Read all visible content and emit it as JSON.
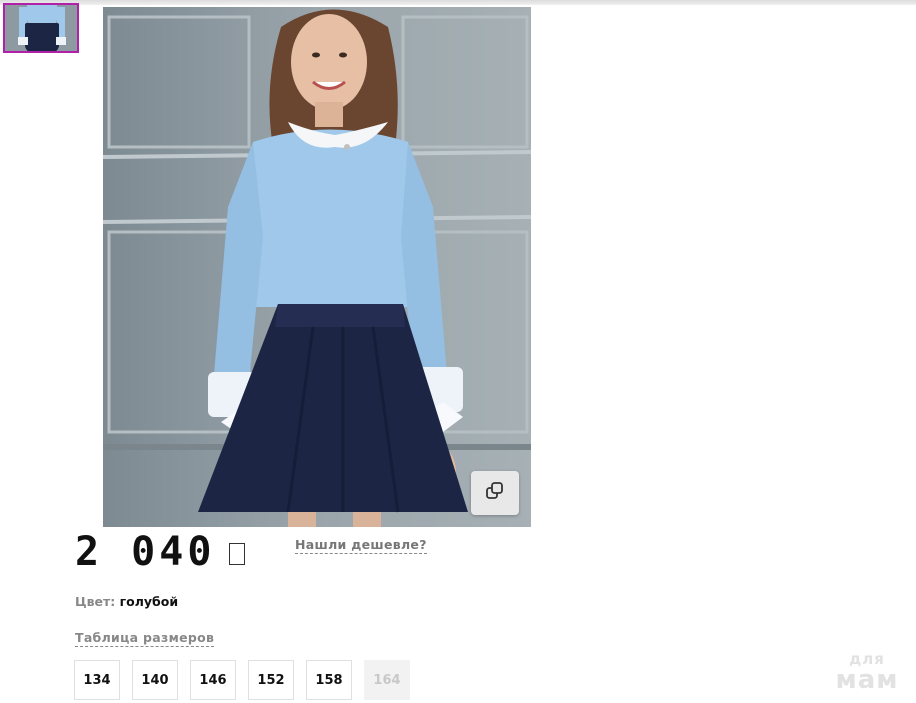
{
  "product": {
    "thumbnail_alt": "product-thumbnail",
    "price": "2 040",
    "currency_symbol": "□",
    "cheaper_link": "Нашли дешевле?",
    "color_label": "Цвет:",
    "color_value": "голубой",
    "size_table_link": "Таблица размеров",
    "sizes": [
      {
        "label": "134",
        "available": true
      },
      {
        "label": "140",
        "available": true
      },
      {
        "label": "146",
        "available": true
      },
      {
        "label": "152",
        "available": true
      },
      {
        "label": "158",
        "available": true
      },
      {
        "label": "164",
        "available": false
      }
    ],
    "zoom_icon": "copy-icon"
  },
  "watermark": {
    "line1": "для",
    "line2": "мам"
  },
  "colors": {
    "thumbnail_selected_border": "#b020a8",
    "blouse": "#9fc8ea",
    "skirt": "#1d2545",
    "wall": "#8d9aa2"
  }
}
